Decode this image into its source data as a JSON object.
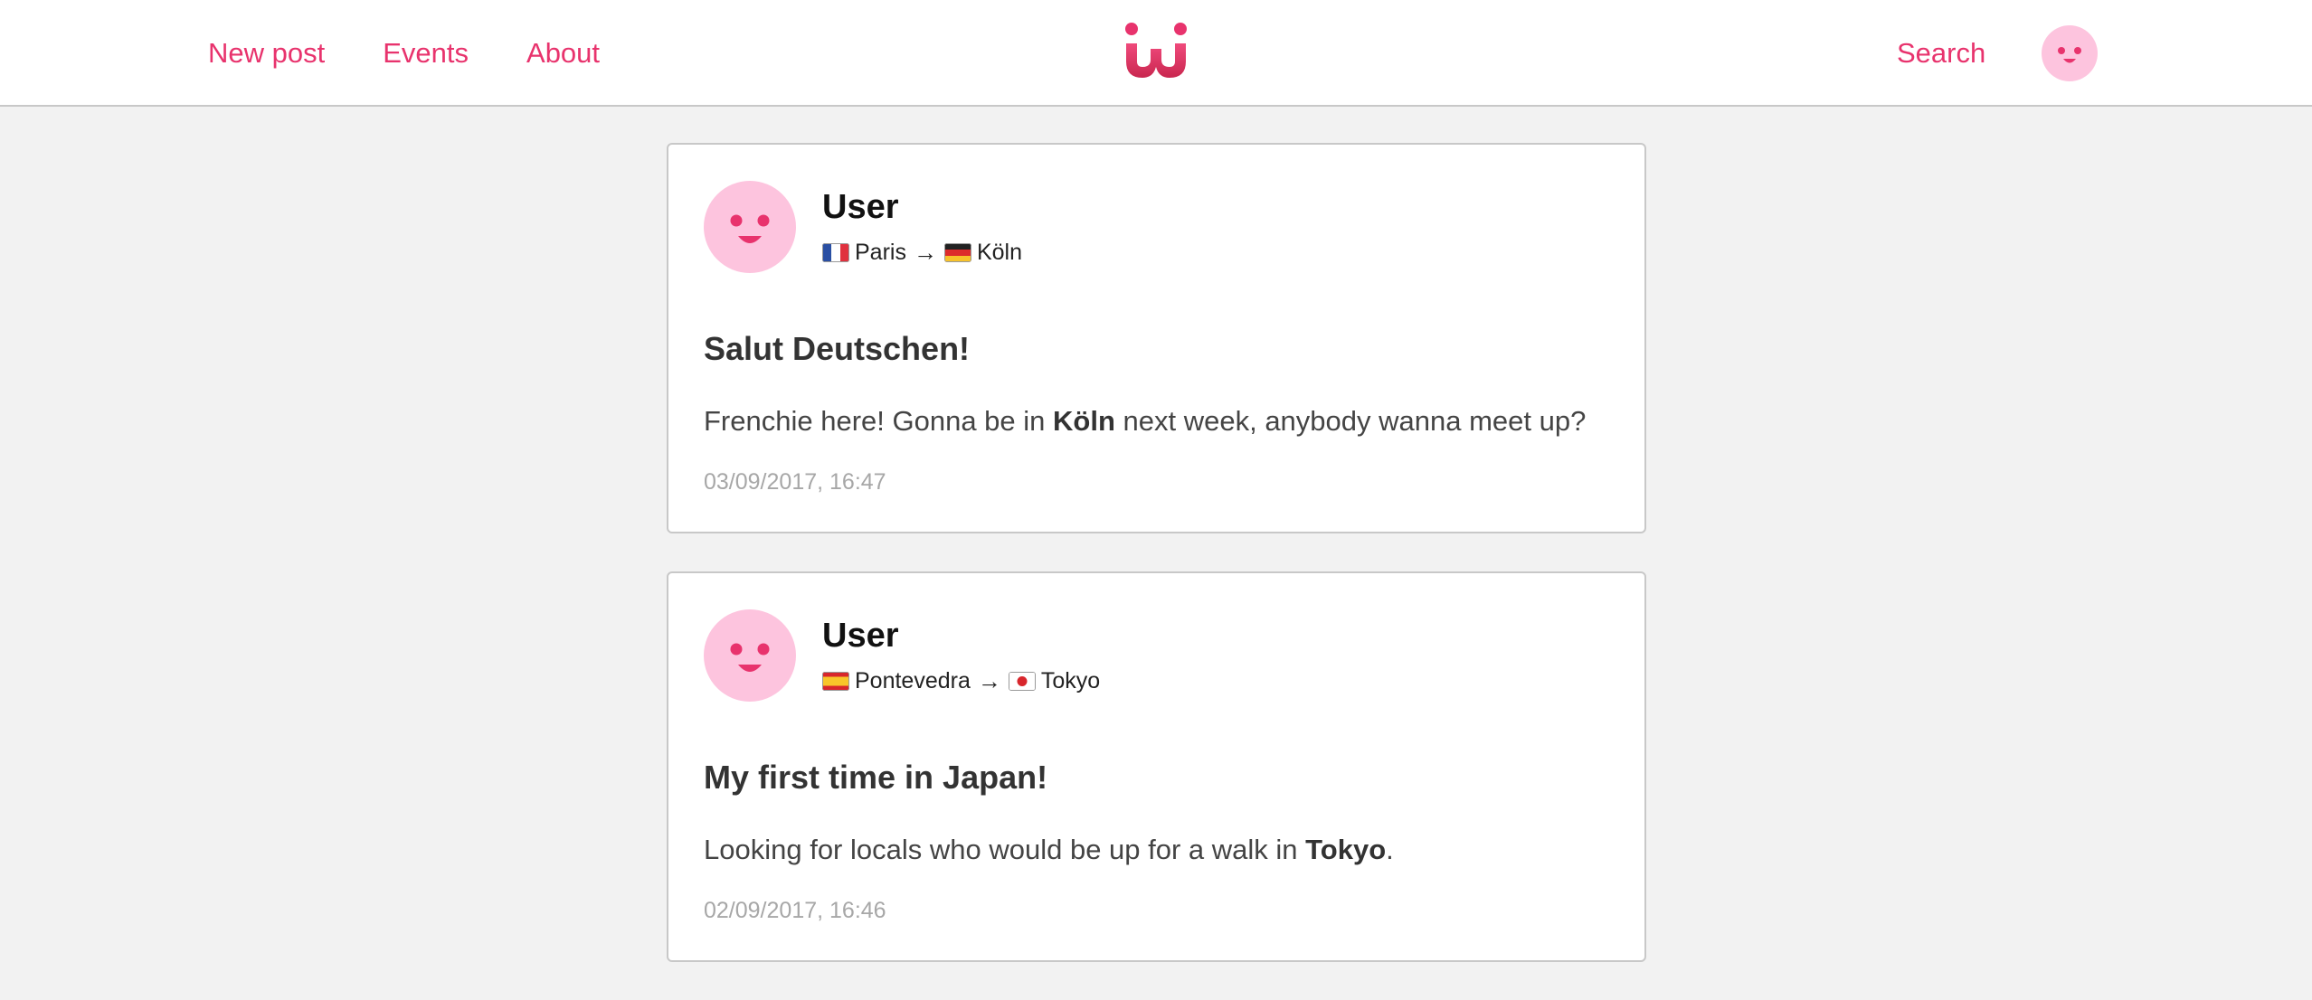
{
  "nav": {
    "links": [
      "New post",
      "Events",
      "About"
    ],
    "search_label": "Search",
    "accent_color": "#e8336d",
    "logo_icon": "w-logo-icon",
    "avatar_icon": "smiley-avatar-icon"
  },
  "posts": [
    {
      "author": "User",
      "from_city": "Paris",
      "from_flag": "france-flag-icon",
      "to_city": "Köln",
      "to_flag": "germany-flag-icon",
      "title": "Salut Deutschen!",
      "body_before": "Frenchie here! Gonna be in ",
      "body_bold": "Köln",
      "body_after": " next week, anybody wanna meet up?",
      "date": "03/09/2017, 16:47"
    },
    {
      "author": "User",
      "from_city": "Pontevedra",
      "from_flag": "spain-flag-icon",
      "to_city": "Tokyo",
      "to_flag": "japan-flag-icon",
      "title": "My first time in Japan!",
      "body_before": "Looking for locals who would be up for a walk in ",
      "body_bold": "Tokyo",
      "body_after": ".",
      "date": "02/09/2017, 16:46"
    }
  ],
  "route_arrow": "→"
}
